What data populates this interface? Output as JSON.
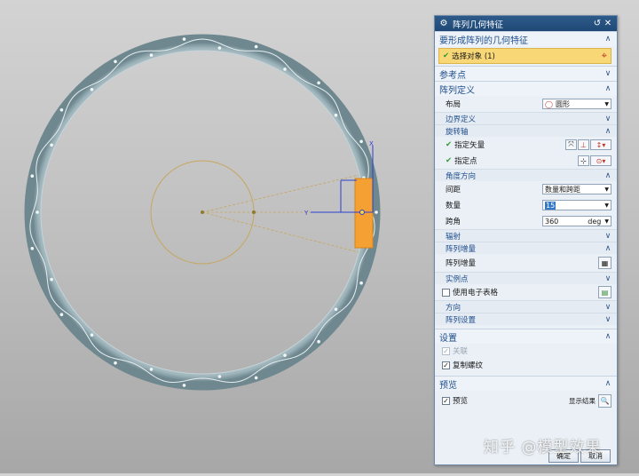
{
  "dialog": {
    "title": "阵列几何特征",
    "title_icon": "gear-icon",
    "reset_icon": "reset-icon",
    "close_icon": "close-icon"
  },
  "sections": {
    "feature": {
      "label": "要形成阵列的几何特征",
      "select_label": "选择对象 (1)"
    },
    "reference": {
      "label": "参考点"
    },
    "pattern": {
      "label": "阵列定义",
      "layout_label": "布局",
      "layout_value": "圆形",
      "boundary_label": "边界定义",
      "axis_label": "旋转轴",
      "vector_label": "指定矢量",
      "point_label": "指定点",
      "angle_dir_label": "角度方向",
      "spacing_label": "间距",
      "spacing_value": "数量和跨距",
      "count_label": "数量",
      "count_value": "15",
      "span_label": "跨角",
      "span_value": "360",
      "span_unit": "deg",
      "radiation_label": "辐射",
      "increment_section": "阵列增量",
      "increment_label": "阵列增量",
      "instance_label": "实例点",
      "spreadsheet_label": "使用电子表格",
      "direction_label": "方向",
      "settings_label": "阵列设置"
    },
    "settings": {
      "label": "设置",
      "assoc_label": "关联",
      "copy_thread_label": "复制螺纹"
    },
    "preview": {
      "label": "预览",
      "preview_label": "预览",
      "show_result_label": "显示结果"
    }
  },
  "buttons": {
    "ok": "确定",
    "cancel": "取消"
  },
  "viewport": {
    "axis_x": "X",
    "axis_y": "Y"
  },
  "watermark": "知乎 @模型效果"
}
